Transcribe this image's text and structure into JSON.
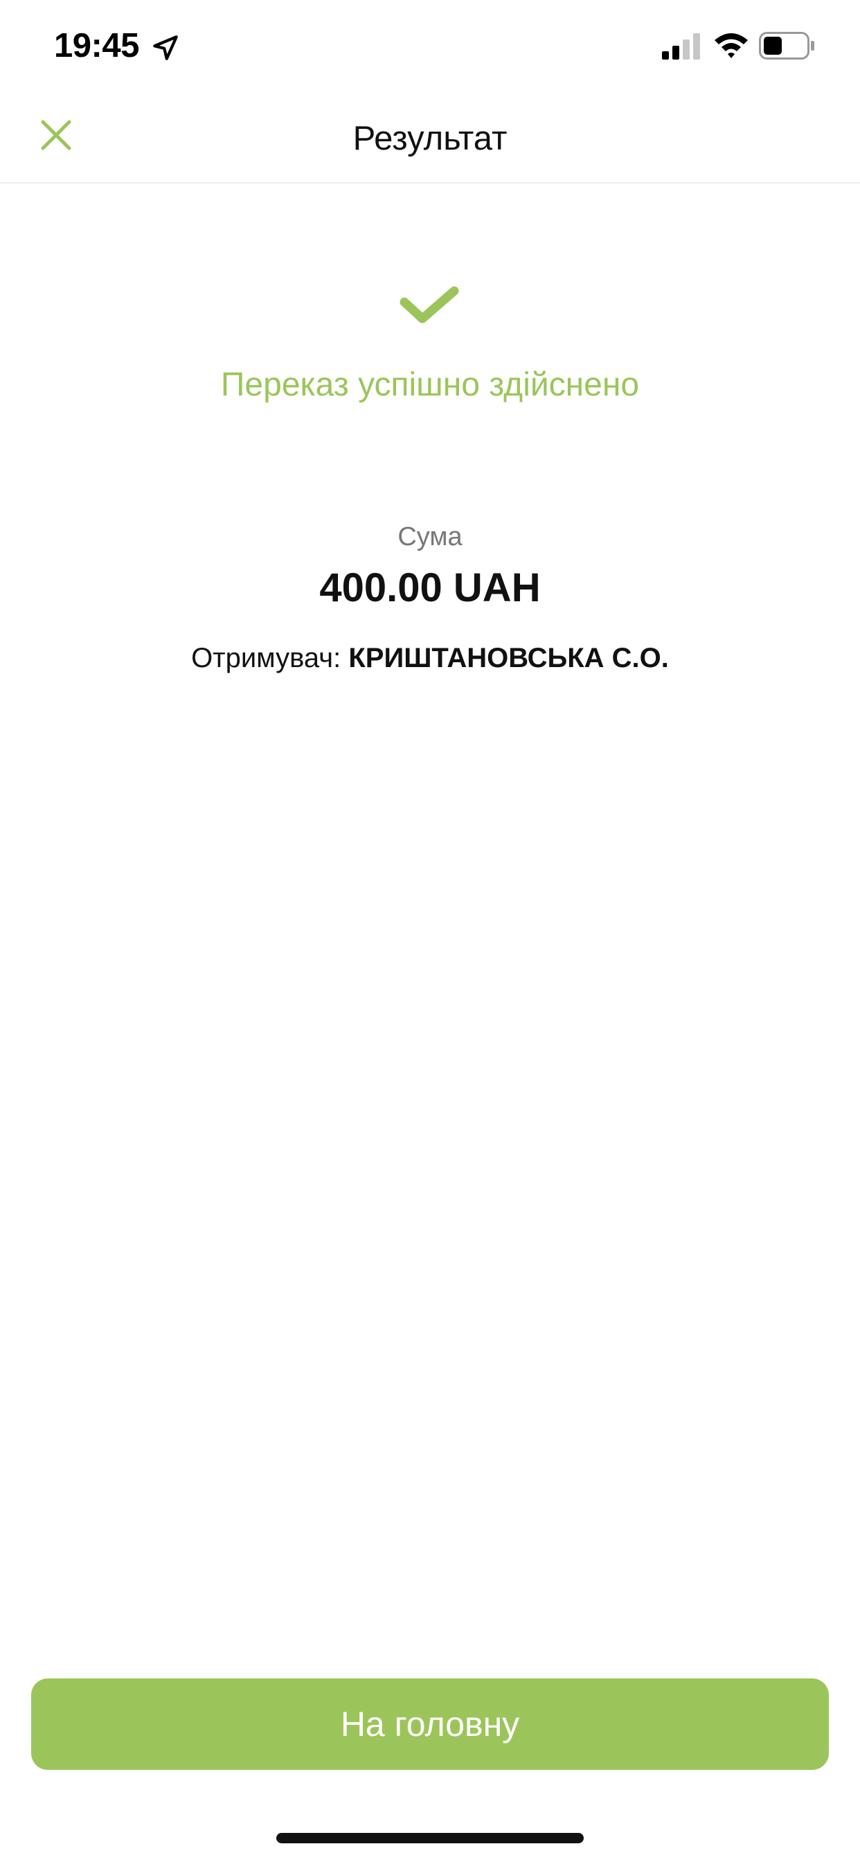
{
  "status_bar": {
    "time": "19:45"
  },
  "header": {
    "title": "Результат",
    "close_icon": "close-icon"
  },
  "result": {
    "icon": "check-icon",
    "message": "Переказ успішно здійснено",
    "amount_label": "Сума",
    "amount": "400.00 UAH",
    "recipient_label": "Отримувач:",
    "recipient_name": "КРИШТАНОВСЬКА С.О."
  },
  "footer": {
    "home_button_label": "На головну"
  },
  "colors": {
    "accent": "#9bc55a",
    "secondary_text": "#777777",
    "primary_text": "#111111"
  }
}
